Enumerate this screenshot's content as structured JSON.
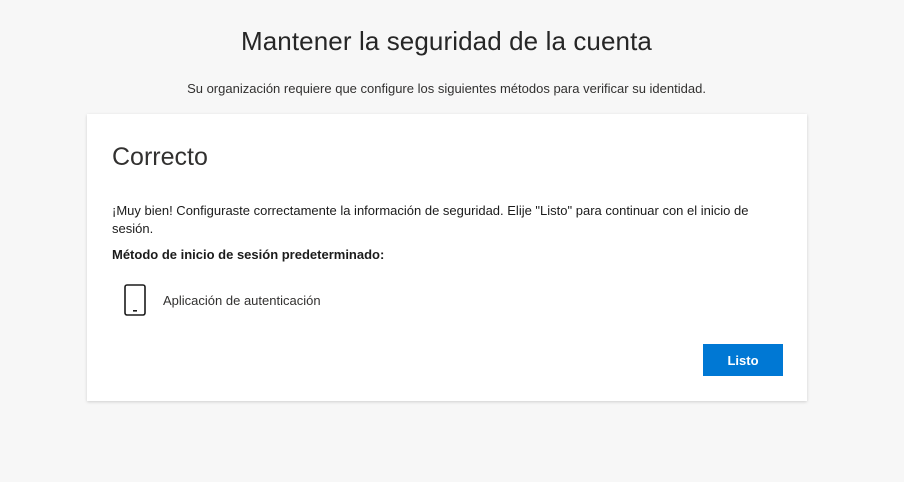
{
  "header": {
    "title": "Mantener la seguridad de la cuenta",
    "subtitle": "Su organización requiere que configure los siguientes métodos para verificar su identidad."
  },
  "card": {
    "heading": "Correcto",
    "message": "¡Muy bien! Configuraste correctamente la información de seguridad. Elije \"Listo\" para continuar con el inicio de sesión.",
    "default_method_label": "Método de inicio de sesión predeterminado:",
    "method": {
      "icon": "phone-icon",
      "name": "Aplicación de autenticación"
    },
    "done_label": "Listo"
  },
  "colors": {
    "background": "#f7f7f7",
    "card": "#ffffff",
    "accent": "#0078d4"
  }
}
